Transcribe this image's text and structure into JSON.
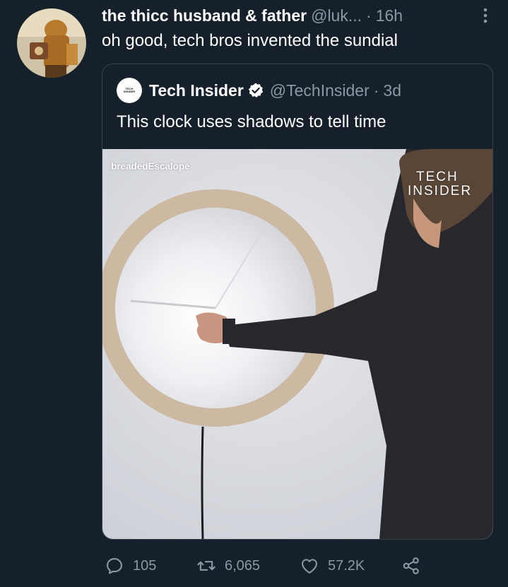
{
  "tweet": {
    "display_name": "the thicc husband & father",
    "handle": "@luk...",
    "separator": "·",
    "time": "16h",
    "text": "oh good, tech bros invented the sundial"
  },
  "quoted_tweet": {
    "avatar_text_line1": "TECH",
    "avatar_text_line2": "INSIDER",
    "display_name": "Tech Insider",
    "handle": "@TechInsider",
    "separator": "·",
    "time": "3d",
    "text": "This clock uses shadows to tell time",
    "media": {
      "watermark": "breadedEscalope",
      "brand_line1": "TECH",
      "brand_line2": "INSIDER"
    }
  },
  "actions": {
    "replies": "105",
    "retweets": "6,065",
    "likes": "57.2K"
  },
  "colors": {
    "background": "#15202b",
    "muted_text": "#8b98a5",
    "border": "#38444d",
    "verified": "#ffffff"
  },
  "icons": [
    "more-icon",
    "verified-icon",
    "reply-icon",
    "retweet-icon",
    "like-icon",
    "share-icon"
  ]
}
